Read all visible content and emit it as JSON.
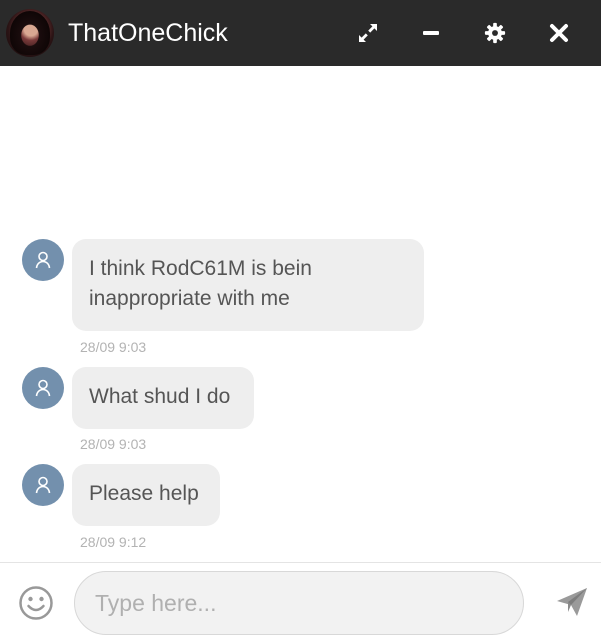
{
  "header": {
    "title": "ThatOneChick",
    "buttons": [
      "expand-icon",
      "minimize-icon",
      "gear-icon",
      "close-icon"
    ]
  },
  "messages": [
    {
      "lines": [
        "I think RodC61M is bein",
        "inappropriate with me"
      ],
      "time": "28/09 9:03"
    },
    {
      "lines": [
        "What shud I do"
      ],
      "time": "28/09 9:03"
    },
    {
      "lines": [
        "Please help"
      ],
      "time": "28/09 9:12"
    }
  ],
  "composer": {
    "placeholder": "Type here..."
  },
  "colors": {
    "header_bg": "#2a2a2a",
    "avatar_bg": "#7390ad",
    "bubble_bg": "#eeeeee",
    "timestamp": "#b3b3b3"
  }
}
